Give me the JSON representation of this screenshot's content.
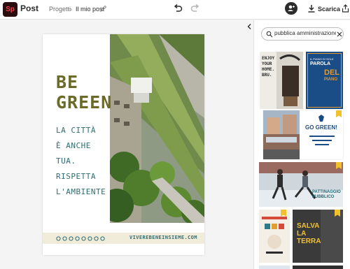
{
  "app": {
    "logo": "Sp",
    "name": "Post"
  },
  "breadcrumb": {
    "parent": "Progetti",
    "separator": "›",
    "current": "Il mio post"
  },
  "toolbar": {
    "download_label": "Scarica"
  },
  "search": {
    "value": "pubblica amministrazione"
  },
  "poster": {
    "title": "BE\nGREEN",
    "body": "LA CITTÀ\nÈ ANCHE\nTUA.\nRISPETTA\nL'AMBIENTE",
    "url": "VIVEREBENEINSIEME.COM",
    "dots_count": 8,
    "title_color": "#6a6a2a",
    "body_color": "#2f6d73"
  },
  "templates": {
    "t1": {
      "text": "ENJOY\nYOUR\nHOME.\nBRU."
    },
    "t2": {
      "line1": "IL PIANO DI SOLE",
      "line2": "PAROLA",
      "line3": "DEL",
      "line4": "PIANO"
    },
    "t3": {
      "text": "GO GREEN!"
    },
    "t4": {
      "text": "PATTINAGGIO\nPUBBLICO"
    },
    "t5": {
      "text": "SALVA\nLA\nTERRA"
    }
  },
  "colors": {
    "accent": "#2f6d73",
    "brand_logo_bg": "#2b0d10",
    "brand_logo_fg": "#ff3b4a",
    "pin": "#f2c12e"
  }
}
